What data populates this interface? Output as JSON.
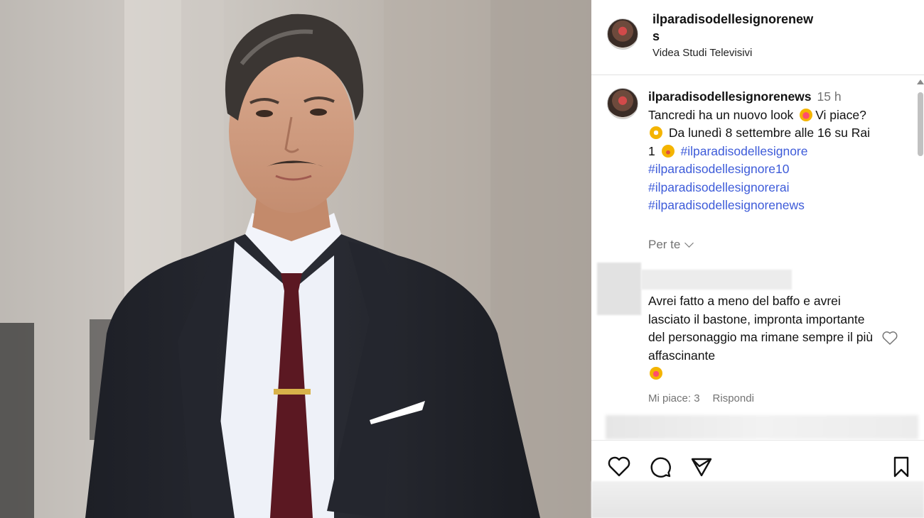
{
  "header": {
    "username": "ilparadisodellesignorenews",
    "location": "Videa Studi Televisivi"
  },
  "post": {
    "username": "ilparadisodellesignorenews",
    "time": "15 h",
    "caption_line1": "Tancredi ha un nuovo look",
    "caption_line1b": "Vi piace?",
    "caption_line2": "Da lunedì 8 settembre alle 16 su Rai",
    "caption_line3": "1",
    "hashtags": [
      "#ilparadisodellesignore",
      "#ilparadisodellesignore10",
      "#ilparadisodellesignorerai",
      "#ilparadisodellesignorenews"
    ],
    "per_te": "Per te"
  },
  "comment": {
    "text": "Avrei fatto a meno del baffo e avrei lasciato il bastone, impronta importante del personaggio ma rimane sempre il più affascinante",
    "likes": "Mi piace: 3",
    "reply": "Rispondi"
  },
  "icons": {
    "like": "heart-icon",
    "comment": "comment-icon",
    "share": "send-icon",
    "save": "bookmark-icon"
  },
  "colors": {
    "hashtag": "#3d5bd9",
    "muted": "#737373"
  }
}
